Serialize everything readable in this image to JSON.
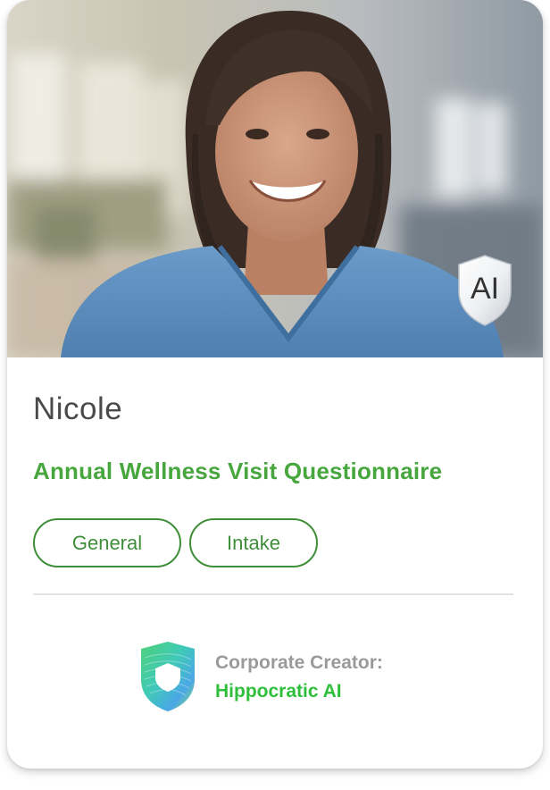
{
  "agent": {
    "name": "Nicole",
    "badge": "AI",
    "title": "Annual Wellness Visit Questionnaire",
    "tags": [
      "General",
      "Intake"
    ]
  },
  "creator": {
    "label": "Corporate Creator:",
    "name": "Hippocratic AI"
  },
  "colors": {
    "accent_green": "#47a63d",
    "tag_green": "#3f8f3a",
    "creator_green": "#2fbf3a",
    "scrubs_blue": "#5d8fc0"
  }
}
